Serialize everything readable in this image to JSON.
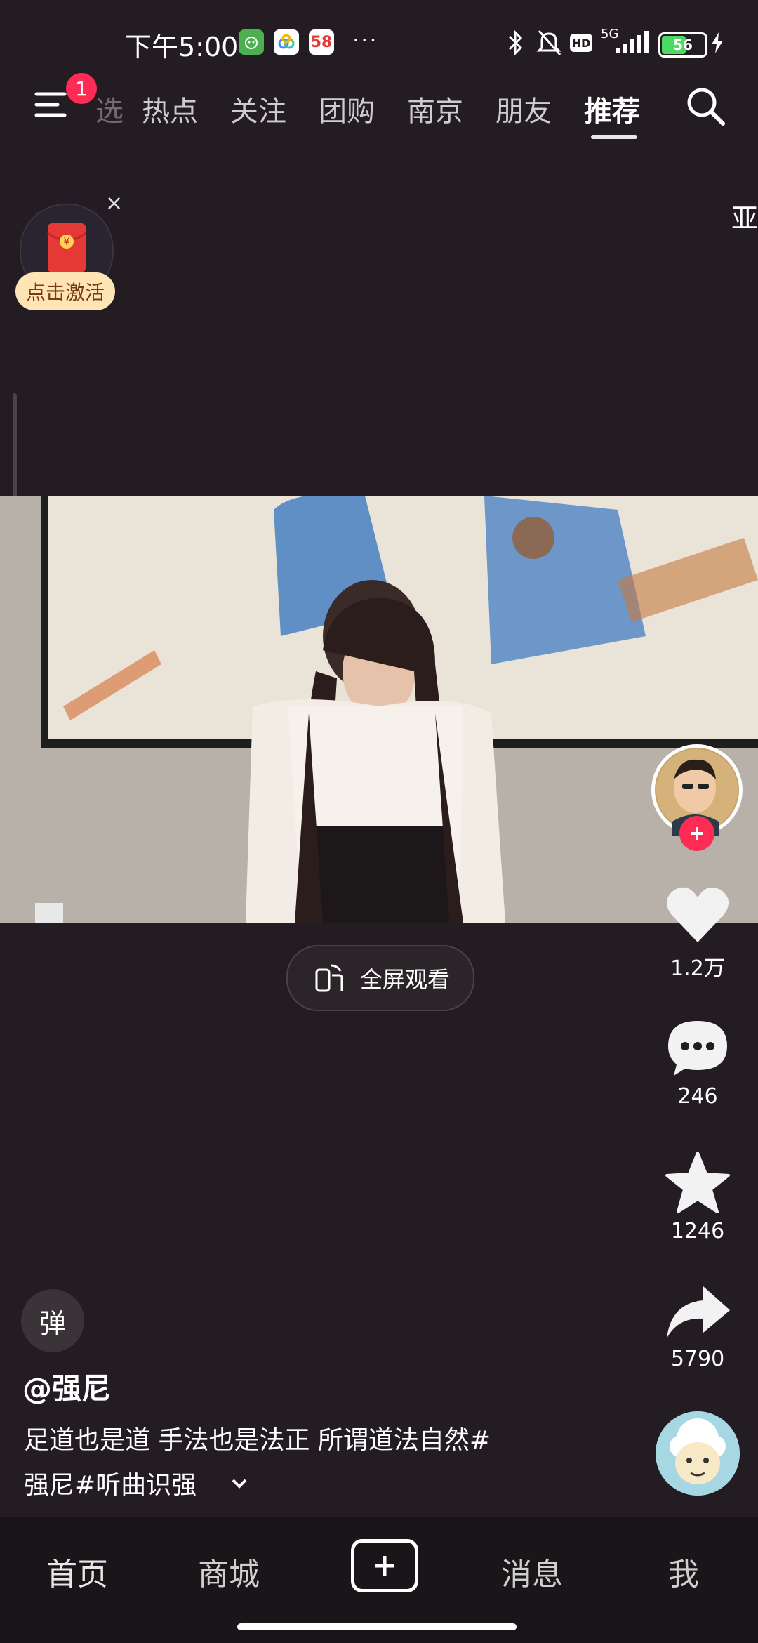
{
  "status_bar": {
    "time": "下午5:00",
    "app_58_label": "58",
    "network": "5G",
    "hd_label": "HD",
    "battery": "56"
  },
  "top_nav": {
    "menu_badge": "1",
    "partial_tab": "选",
    "tabs": [
      "热点",
      "关注",
      "团购",
      "南京",
      "朋友",
      "推荐"
    ],
    "active_tab": "推荐"
  },
  "widget": {
    "activate_label": "点击激活",
    "close_symbol": "×",
    "edge_text": "亚"
  },
  "video": {
    "fullscreen_label": "全屏观看"
  },
  "actions": {
    "like_count": "1.2万",
    "comment_count": "246",
    "favorite_count": "1246",
    "share_count": "5790"
  },
  "post": {
    "danmaku_label": "弹",
    "author": "@强尼",
    "caption_line1": "足道也是道 手法也是法正 所谓道法自然#",
    "caption_line2": "强尼#听曲识强"
  },
  "bottom_nav": {
    "items": [
      "首页",
      "商城",
      "消息",
      "我"
    ]
  },
  "colors": {
    "accent": "#fe2c55",
    "background": "#231c22",
    "nav_bg": "#1a1519"
  }
}
